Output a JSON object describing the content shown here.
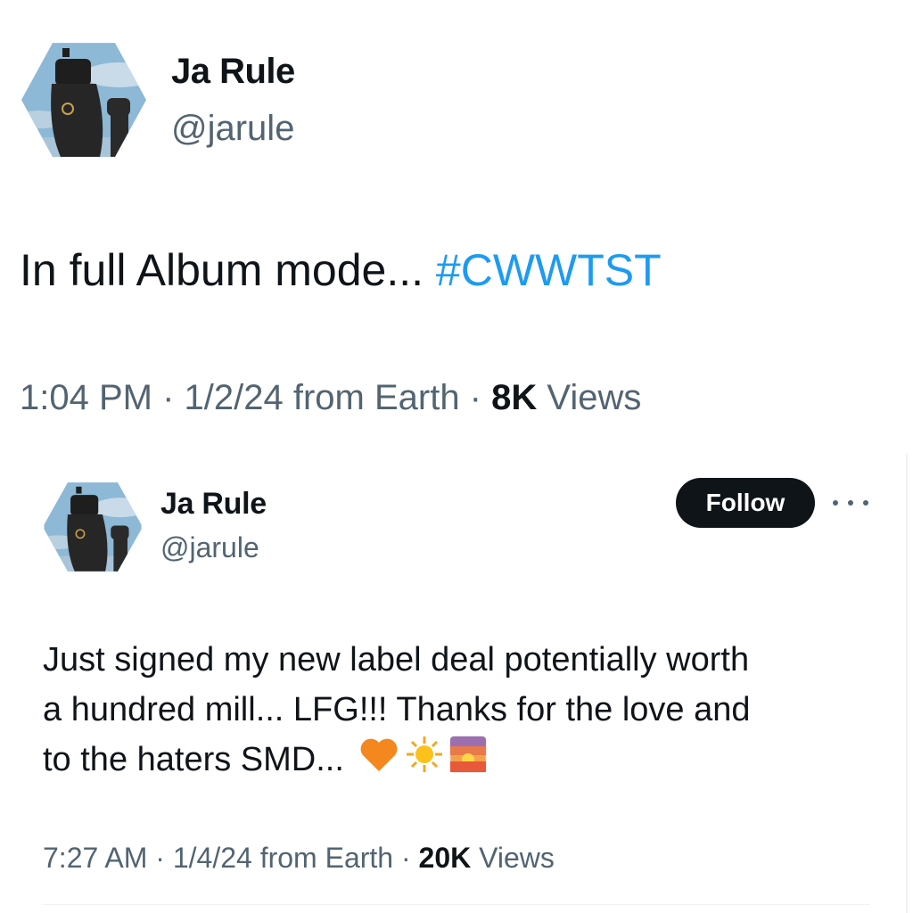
{
  "tweet1": {
    "name": "Ja Rule",
    "handle": "@jarule",
    "text": "In full Album mode... ",
    "hashtag": "#CWWTST",
    "time": "1:04 PM",
    "date": "1/2/24 from Earth",
    "views_count": "8K",
    "views_label": "Views",
    "separator": " · "
  },
  "tweet2": {
    "name": "Ja Rule",
    "handle": "@jarule",
    "follow_label": "Follow",
    "text_line1": "Just signed my new label deal potentially worth",
    "text_line2": "a hundred mill... LFG!!! Thanks for the love and",
    "text_line3": "to the haters SMD...",
    "emojis": [
      "orange-heart-icon",
      "sun-icon",
      "sunrise-icon"
    ],
    "time": "7:27 AM",
    "date": "1/4/24 from Earth",
    "views_count": "20K",
    "views_label": "Views",
    "separator": " · "
  },
  "colors": {
    "hashtag": "#1d9bf0",
    "secondary_text": "#536471",
    "primary_text": "#0f1419",
    "follow_button": "#0f1419"
  }
}
